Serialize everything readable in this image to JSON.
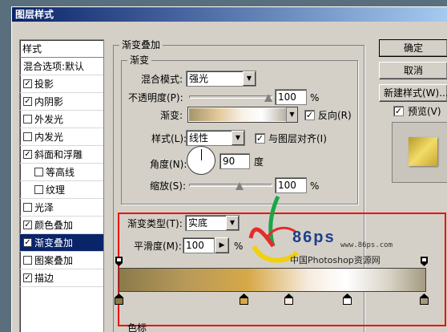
{
  "window": {
    "title": "图层样式"
  },
  "sidebar": {
    "header": "样式",
    "items": [
      {
        "label": "混合选项:默认",
        "checkbox": false,
        "sub": false,
        "selected": false
      },
      {
        "label": "投影",
        "checkbox": true,
        "checked": true,
        "sub": false
      },
      {
        "label": "内阴影",
        "checkbox": true,
        "checked": true,
        "sub": false
      },
      {
        "label": "外发光",
        "checkbox": true,
        "checked": false,
        "sub": false
      },
      {
        "label": "内发光",
        "checkbox": true,
        "checked": false,
        "sub": false
      },
      {
        "label": "斜面和浮雕",
        "checkbox": true,
        "checked": true,
        "sub": false
      },
      {
        "label": "等高线",
        "checkbox": true,
        "checked": false,
        "sub": true
      },
      {
        "label": "纹理",
        "checkbox": true,
        "checked": false,
        "sub": true
      },
      {
        "label": "光泽",
        "checkbox": true,
        "checked": false,
        "sub": false
      },
      {
        "label": "颜色叠加",
        "checkbox": true,
        "checked": true,
        "sub": false
      },
      {
        "label": "渐变叠加",
        "checkbox": true,
        "checked": true,
        "sub": false,
        "selected": true
      },
      {
        "label": "图案叠加",
        "checkbox": true,
        "checked": false,
        "sub": false
      },
      {
        "label": "描边",
        "checkbox": true,
        "checked": true,
        "sub": false
      }
    ]
  },
  "panel": {
    "group_title": "渐变叠加",
    "sub_group": "渐变",
    "blend_mode_label": "混合模式:",
    "blend_mode_value": "强光",
    "opacity_label": "不透明度(P):",
    "opacity_value": "100",
    "percent": "%",
    "gradient_label": "渐变:",
    "reverse_label": "反向(R)",
    "style_label": "样式(L):",
    "style_value": "线性",
    "align_label": "与图层对齐(I)",
    "angle_label": "角度(N):",
    "angle_value": "90",
    "degree": "度",
    "scale_label": "缩放(S):",
    "scale_value": "100",
    "bottom_label": "色标"
  },
  "gradient_editor": {
    "type_label": "渐变类型(T):",
    "type_value": "实底",
    "smooth_label": "平滑度(M):",
    "smooth_value": "100",
    "percent": "%"
  },
  "buttons": {
    "ok": "确定",
    "cancel": "取消",
    "new_style": "新建样式(W)...",
    "preview": "预览(V)"
  },
  "watermark": {
    "logo": "86ps",
    "url": "www.86ps.com",
    "site": "中国Photoshop资源网"
  },
  "colors": {
    "gradient_stops": [
      "#8a7a4a",
      "#d7a848",
      "#f6ece0",
      "#ffffff",
      "#a49a80"
    ],
    "selected": "#0a246a",
    "title_start": "#0a246a",
    "title_end": "#a6caf0",
    "frame": "#e11111"
  }
}
